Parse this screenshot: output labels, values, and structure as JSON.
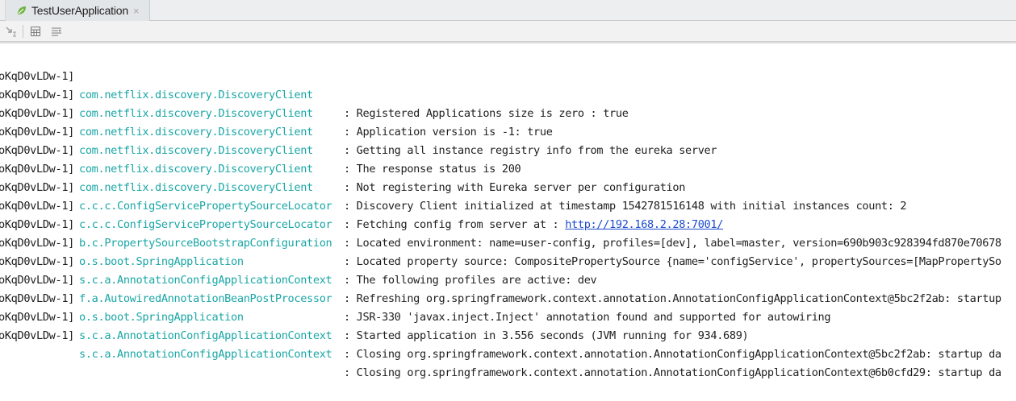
{
  "window": {
    "tab_title": "TestUserApplication",
    "tab_close": "×",
    "tab_icon": "spring-leaf-icon",
    "tab_icon_color": "#6cb33e"
  },
  "toolbar": {
    "icons": [
      "scroll-to-end-icon",
      "table-icon",
      "soft-wrap-icon"
    ]
  },
  "colors": {
    "logger": "#1aa6a6",
    "text": "#1e1e1e",
    "link": "#1b4ccf"
  },
  "console": {
    "lines": [
      {
        "thread": "oKqD0vLDw-1]",
        "logger": "com.netflix.discovery.DiscoveryClient",
        "msg": ": Registered Applications size is zero : true"
      },
      {
        "thread": "oKqD0vLDw-1]",
        "logger": "com.netflix.discovery.DiscoveryClient",
        "msg": ": Application version is -1: true"
      },
      {
        "thread": "oKqD0vLDw-1]",
        "logger": "com.netflix.discovery.DiscoveryClient",
        "msg": ": Getting all instance registry info from the eureka server"
      },
      {
        "thread": "oKqD0vLDw-1]",
        "logger": "com.netflix.discovery.DiscoveryClient",
        "msg": ": The response status is 200"
      },
      {
        "thread": "oKqD0vLDw-1]",
        "logger": "com.netflix.discovery.DiscoveryClient",
        "msg": ": Not registering with Eureka server per configuration"
      },
      {
        "thread": "oKqD0vLDw-1]",
        "logger": "com.netflix.discovery.DiscoveryClient",
        "msg": ": Discovery Client initialized at timestamp 1542781516148 with initial instances count: 2"
      },
      {
        "thread": "oKqD0vLDw-1]",
        "logger": "c.c.c.ConfigServicePropertySourceLocator",
        "msg": ": Fetching config from server at : ",
        "link": "http://192.168.2.28:7001/"
      },
      {
        "thread": "oKqD0vLDw-1]",
        "logger": "c.c.c.ConfigServicePropertySourceLocator",
        "msg": ": Located environment: name=user-config, profiles=[dev], label=master, version=690b903c928394fd870e70678"
      },
      {
        "thread": "oKqD0vLDw-1]",
        "logger": "b.c.PropertySourceBootstrapConfiguration",
        "msg": ": Located property source: CompositePropertySource {name='configService', propertySources=[MapPropertySo"
      },
      {
        "thread": "oKqD0vLDw-1]",
        "logger": "o.s.boot.SpringApplication",
        "msg": ": The following profiles are active: dev"
      },
      {
        "thread": "oKqD0vLDw-1]",
        "logger": "s.c.a.AnnotationConfigApplicationContext",
        "msg": ": Refreshing org.springframework.context.annotation.AnnotationConfigApplicationContext@5bc2f2ab: startup"
      },
      {
        "thread": "oKqD0vLDw-1]",
        "logger": "f.a.AutowiredAnnotationBeanPostProcessor",
        "msg": ": JSR-330 'javax.inject.Inject' annotation found and supported for autowiring"
      },
      {
        "thread": "oKqD0vLDw-1]",
        "logger": "o.s.boot.SpringApplication",
        "msg": ": Started application in 3.556 seconds (JVM running for 934.689)"
      },
      {
        "thread": "oKqD0vLDw-1]",
        "logger": "s.c.a.AnnotationConfigApplicationContext",
        "msg": ": Closing org.springframework.context.annotation.AnnotationConfigApplicationContext@5bc2f2ab: startup da"
      },
      {
        "thread": "oKqD0vLDw-1]",
        "logger": "s.c.a.AnnotationConfigApplicationContext",
        "msg": ": Closing org.springframework.context.annotation.AnnotationConfigApplicationContext@6b0cfd29: startup da"
      }
    ]
  }
}
